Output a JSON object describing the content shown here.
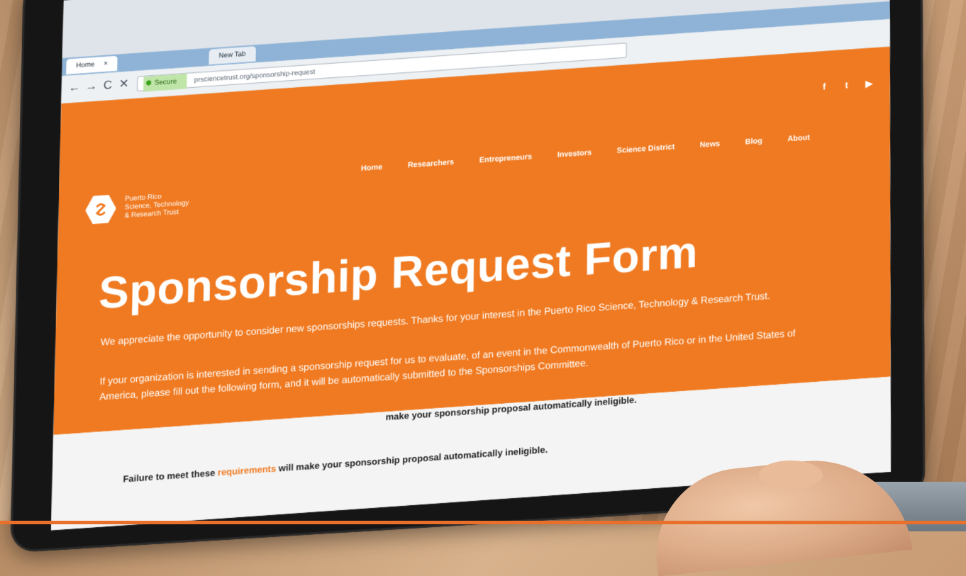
{
  "browser": {
    "tabs": [
      {
        "label": "Home"
      },
      {
        "label": "New Tab"
      }
    ],
    "tab_close": "×",
    "nav": {
      "back": "←",
      "forward": "→",
      "reload": "C",
      "stop": "✕"
    },
    "address_secure": "Secure",
    "address_url": "prsciencetrust.org/sponsorship-request"
  },
  "site": {
    "social": [
      {
        "name": "facebook-icon",
        "glyph": "f"
      },
      {
        "name": "twitter-icon",
        "glyph": "t"
      },
      {
        "name": "youtube-icon",
        "glyph": "▶"
      }
    ],
    "logo": {
      "line1": "Puerto Rico",
      "line2": "Science, Technology",
      "line3": "& Research Trust"
    },
    "nav": [
      "Home",
      "Researchers",
      "Entrepreneurs",
      "Investors",
      "Science District",
      "News",
      "Blog",
      "About"
    ],
    "title": "Sponsorship Request Form",
    "paragraph1": "We appreciate the opportunity to consider new sponsorships requests. Thanks for your interest in the Puerto Rico Science, Technology & Research Trust.",
    "paragraph2": "If your organization is interested in sending a sponsorship request for us to evaluate, of an event in the Commonwealth of Puerto Rico or in the United States of America, please fill out the following form, and it will be automatically submitted to the Sponsorships Committee.",
    "notice": "make your sponsorship proposal automatically ineligible.",
    "failure_prefix": "Failure to meet these ",
    "failure_link": "requirements",
    "failure_suffix": " will make your sponsorship proposal automatically ineligible."
  },
  "colors": {
    "brand_orange": "#f07a21",
    "white": "#ffffff"
  }
}
